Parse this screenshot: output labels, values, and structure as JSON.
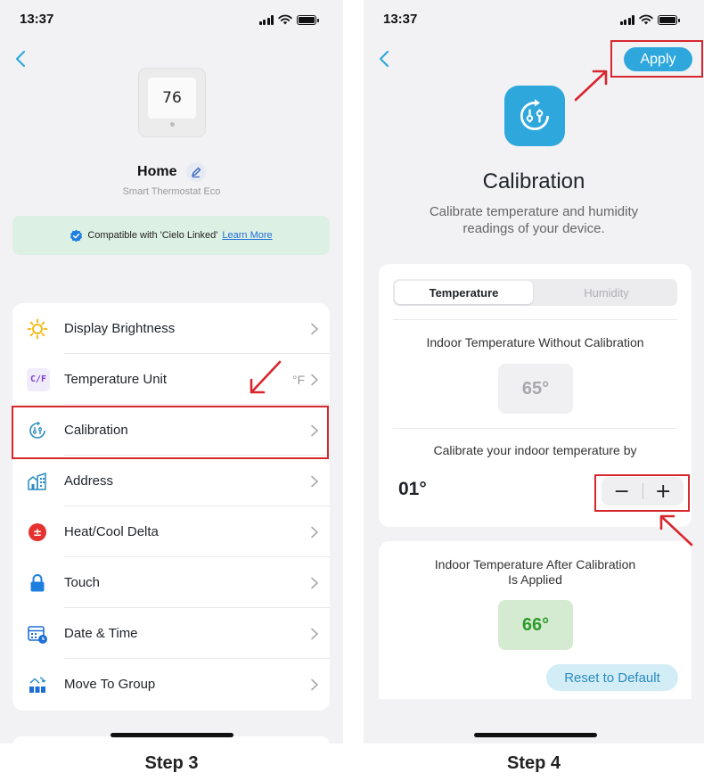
{
  "left_screen": {
    "status_time": "13:37",
    "device": {
      "display_temp": "76",
      "name": "Home",
      "model": "Smart Thermostat Eco"
    },
    "compat": {
      "text": "Compatible with 'Cielo Linked'",
      "link": "Learn More"
    },
    "settings": [
      {
        "label": "Display Brightness",
        "value": "",
        "icon": "sun-icon"
      },
      {
        "label": "Temperature Unit",
        "value": "°F",
        "icon": "cf-unit-icon"
      },
      {
        "label": "Calibration",
        "value": "",
        "icon": "calibration-icon"
      },
      {
        "label": "Address",
        "value": "",
        "icon": "building-icon"
      },
      {
        "label": "Heat/Cool Delta",
        "value": "",
        "icon": "plus-minus-icon"
      },
      {
        "label": "Touch",
        "value": "",
        "icon": "lock-icon"
      },
      {
        "label": "Date & Time",
        "value": "",
        "icon": "calendar-clock-icon"
      },
      {
        "label": "Move To Group",
        "value": "",
        "icon": "move-group-icon"
      }
    ],
    "cf_icon_text": "C/F",
    "plusminus_icon_text": "±",
    "step_label": "Step 3"
  },
  "right_screen": {
    "status_time": "13:37",
    "apply_label": "Apply",
    "title": "Calibration",
    "subtitle_line1": "Calibrate temperature and humidity",
    "subtitle_line2": "readings of your device.",
    "tabs": {
      "active": "Temperature",
      "inactive": "Humidity"
    },
    "without_calibration_label": "Indoor Temperature Without Calibration",
    "without_calibration_value": "65°",
    "calibrate_by_label": "Calibrate your indoor temperature by",
    "offset_value": "01°",
    "minus_label": "−",
    "plus_label": "+",
    "after_label_line1": "Indoor Temperature After Calibration",
    "after_label_line2": "Is Applied",
    "after_value": "66°",
    "reset_label": "Reset to Default",
    "step_label": "Step 4"
  },
  "colors": {
    "accent_blue": "#2ea8dc",
    "highlight_red": "#d7262e",
    "compat_green_bg": "#ddf0e4",
    "after_green": "#2e9b2e"
  }
}
